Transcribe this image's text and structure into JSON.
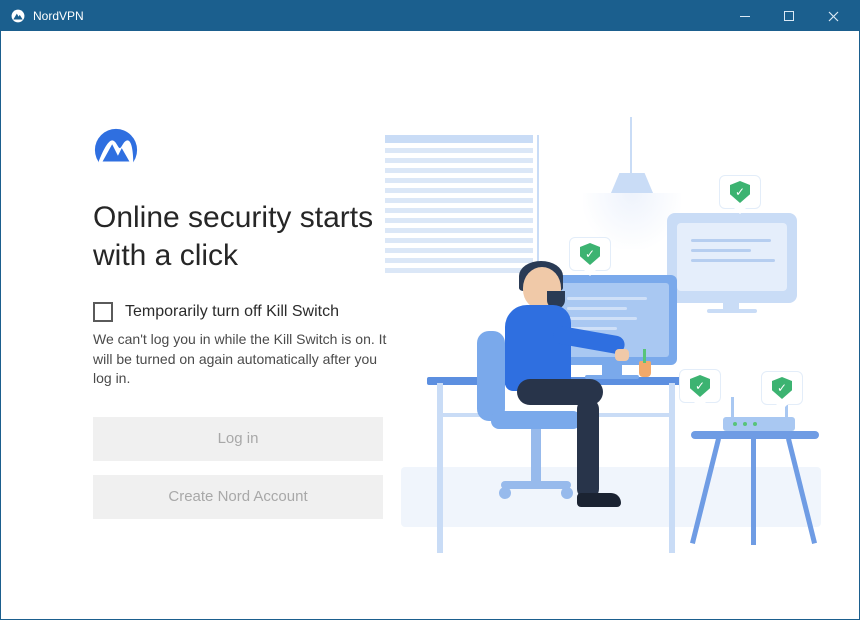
{
  "window": {
    "title": "NordVPN"
  },
  "main": {
    "heading": "Online security starts with a click",
    "checkbox_label": "Temporarily turn off Kill Switch",
    "help_text": "We can't log you in while the Kill Switch is on. It will be turned on again automatically after you log in.",
    "login_button": "Log in",
    "create_account_button": "Create Nord Account"
  },
  "colors": {
    "titlebar": "#1b5f8e",
    "accent": "#2f6fe0",
    "illustration_light": "#c9dcf6",
    "shield_green": "#3cb371"
  },
  "icons": {
    "app_logo": "nordvpn-mountain-icon",
    "minimize": "minimize-icon",
    "maximize": "maximize-icon",
    "close": "close-icon",
    "shield": "shield-check-icon"
  }
}
